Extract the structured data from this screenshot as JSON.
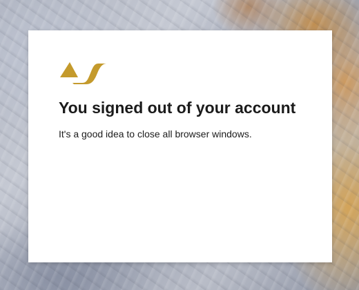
{
  "logo": {
    "icon": "company-logo-icon",
    "color": "#c49a2c"
  },
  "dialog": {
    "title": "You signed out of your account",
    "message": "It's a good idea to close all browser windows."
  }
}
